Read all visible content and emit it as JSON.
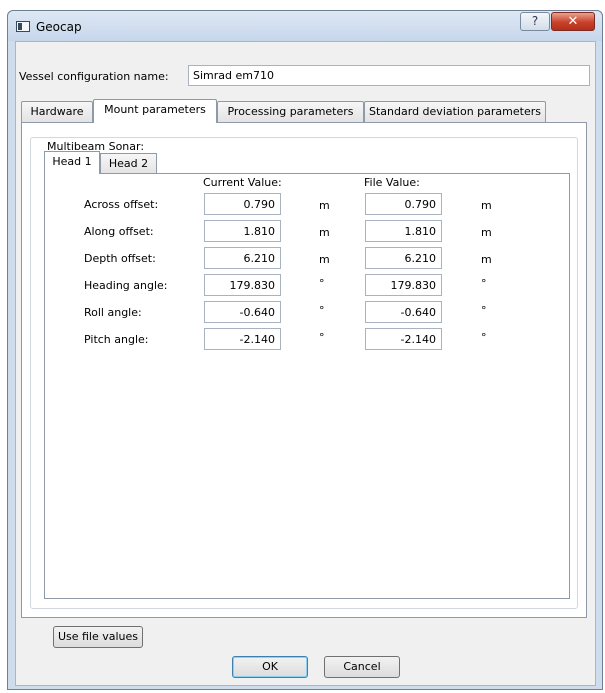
{
  "window": {
    "title": "Geocap",
    "icon": "app-window-icon",
    "help_glyph": "?",
    "close_glyph": "✕"
  },
  "config": {
    "label": "Vessel configuration name:",
    "value": "Simrad em710"
  },
  "tabs": [
    {
      "label": "Hardware"
    },
    {
      "label": "Mount parameters"
    },
    {
      "label": "Processing parameters"
    },
    {
      "label": "Standard deviation parameters"
    }
  ],
  "active_tab": "Mount parameters",
  "group": {
    "title": "Multibeam Sonar:",
    "subtabs": [
      {
        "label": "Head 1"
      },
      {
        "label": "Head 2"
      }
    ],
    "active_subtab": "Head 1",
    "columns": {
      "current": "Current Value:",
      "file": "File Value:"
    },
    "rows": [
      {
        "label": "Across offset:",
        "current": "0.790",
        "unit1": "m",
        "file": "0.790",
        "unit2": "m"
      },
      {
        "label": "Along offset:",
        "current": "1.810",
        "unit1": "m",
        "file": "1.810",
        "unit2": "m"
      },
      {
        "label": "Depth offset:",
        "current": "6.210",
        "unit1": "m",
        "file": "6.210",
        "unit2": "m"
      },
      {
        "label": "Heading angle:",
        "current": "179.830",
        "unit1": "°",
        "file": "179.830",
        "unit2": "°"
      },
      {
        "label": "Roll angle:",
        "current": "-0.640",
        "unit1": "°",
        "file": "-0.640",
        "unit2": "°"
      },
      {
        "label": "Pitch angle:",
        "current": "-2.140",
        "unit1": "°",
        "file": "-2.140",
        "unit2": "°"
      }
    ]
  },
  "buttons": {
    "use_file": "Use file values",
    "ok": "OK",
    "cancel": "Cancel"
  }
}
